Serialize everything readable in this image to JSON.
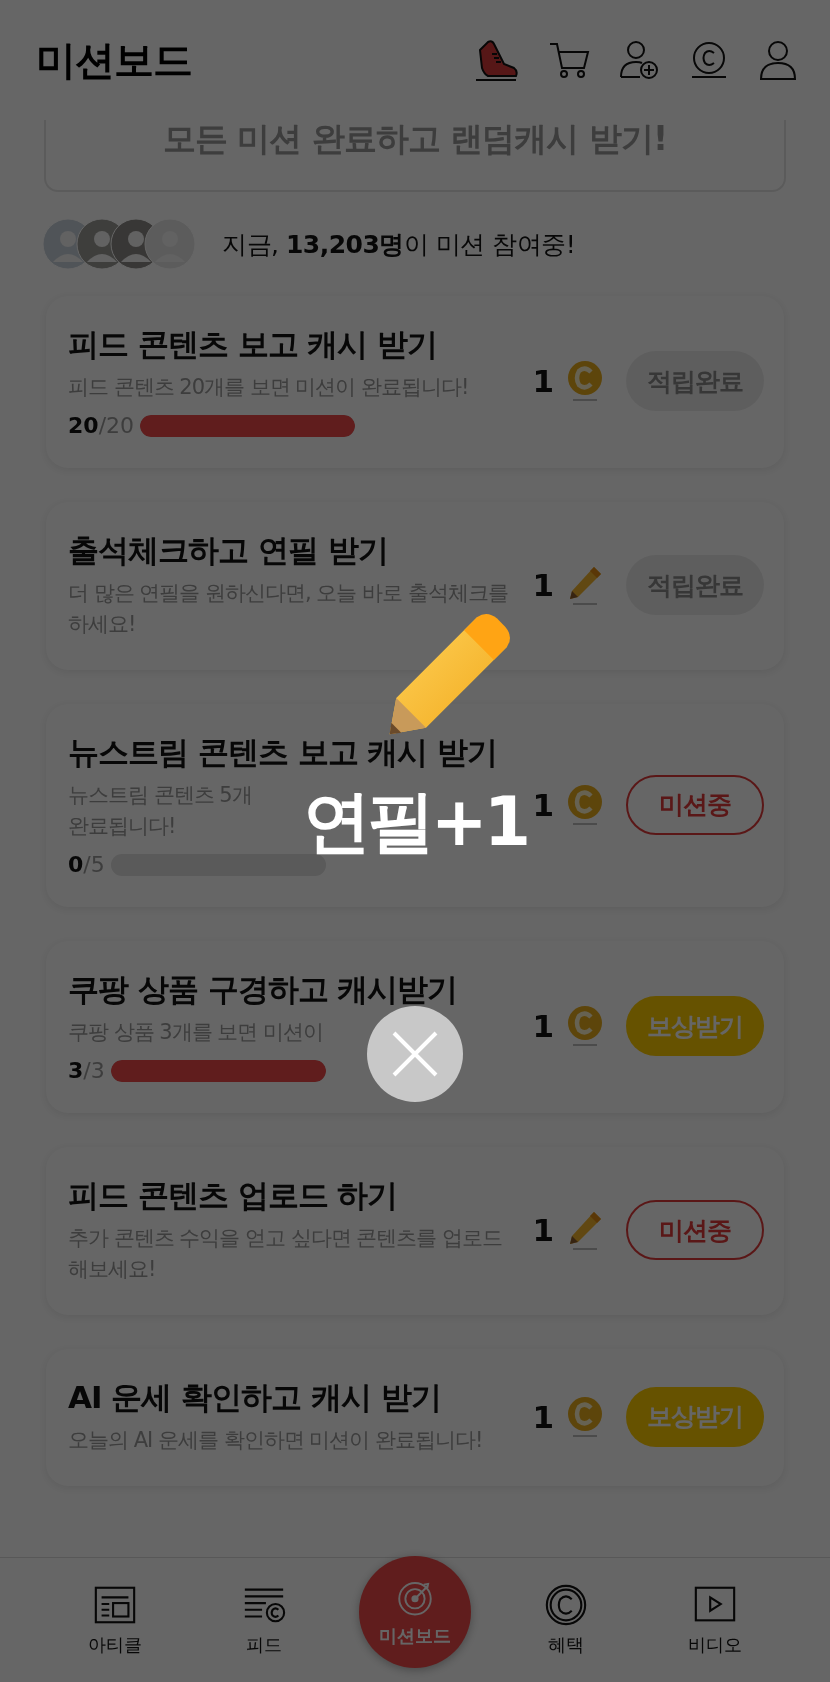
{
  "header": {
    "title": "미션보드"
  },
  "banner": {
    "text": "모든 미션 완료하고 랜덤캐시 받기!"
  },
  "participants": {
    "text": "지금, **13,203명**이 미션 참여중!"
  },
  "missions": [
    {
      "title": "피드 콘텐츠 보고 캐시 받기",
      "description": [
        "피드 콘텐츠 20개를 보면 미션이 완료됩니다!"
      ],
      "progress": {
        "label": "**20**/20",
        "level": 1
      },
      "reward": {
        "amount": "1",
        "kind": "coin"
      },
      "button": {
        "label": "적립완료",
        "kind": "done"
      }
    },
    {
      "title": "출석체크하고 연필 받기",
      "description": [
        "더 많은 연필을 원하신다면, 오늘 바로 출석체크를 하세요!"
      ],
      "reward": {
        "amount": "1",
        "kind": "pencil"
      },
      "button": {
        "label": "적립완료",
        "kind": "done"
      }
    },
    {
      "title": "뉴스트림 콘텐츠 보고 캐시 받기",
      "description": [
        "뉴스트림 콘텐츠 5개",
        "완료됩니다!"
      ],
      "progress": {
        "label": "**0**/5",
        "level": 0
      },
      "reward": {
        "amount": "1",
        "kind": "coin"
      },
      "button": {
        "label": "미션중",
        "kind": "ongoing"
      }
    },
    {
      "title": "쿠팡 상품 구경하고 캐시받기",
      "description": [
        "쿠팡 상품 3개를 보면 미션이"
      ],
      "progress": {
        "label": "**3**/3",
        "level": 1
      },
      "reward": {
        "amount": "1",
        "kind": "coin"
      },
      "button": {
        "label": "보상받기",
        "kind": "claim"
      }
    },
    {
      "title": "피드 콘텐츠 업로드 하기",
      "description": [
        "추가 콘텐츠 수익을 얻고 싶다면 콘텐츠를 업로드해보세요!"
      ],
      "reward": {
        "amount": "1",
        "kind": "pencil"
      },
      "button": {
        "label": "미션중",
        "kind": "ongoing"
      }
    },
    {
      "title": "AI 운세 확인하고 캐시 받기",
      "description": [
        "오늘의 AI 운세를 확인하면 미션이 완료됩니다!"
      ],
      "reward": {
        "amount": "1",
        "kind": "coin"
      },
      "button": {
        "label": "보상받기",
        "kind": "claim"
      }
    }
  ],
  "bottom_nav": [
    {
      "label": "아티클",
      "kind": "article",
      "selected": false
    },
    {
      "label": "피드",
      "kind": "feed",
      "selected": false
    },
    {
      "label": "미션보드",
      "kind": "target",
      "selected": true
    },
    {
      "label": "혜택",
      "kind": "coin",
      "selected": false
    },
    {
      "label": "비디오",
      "kind": "video",
      "selected": false
    }
  ],
  "popup": {
    "text": "연필+1"
  }
}
